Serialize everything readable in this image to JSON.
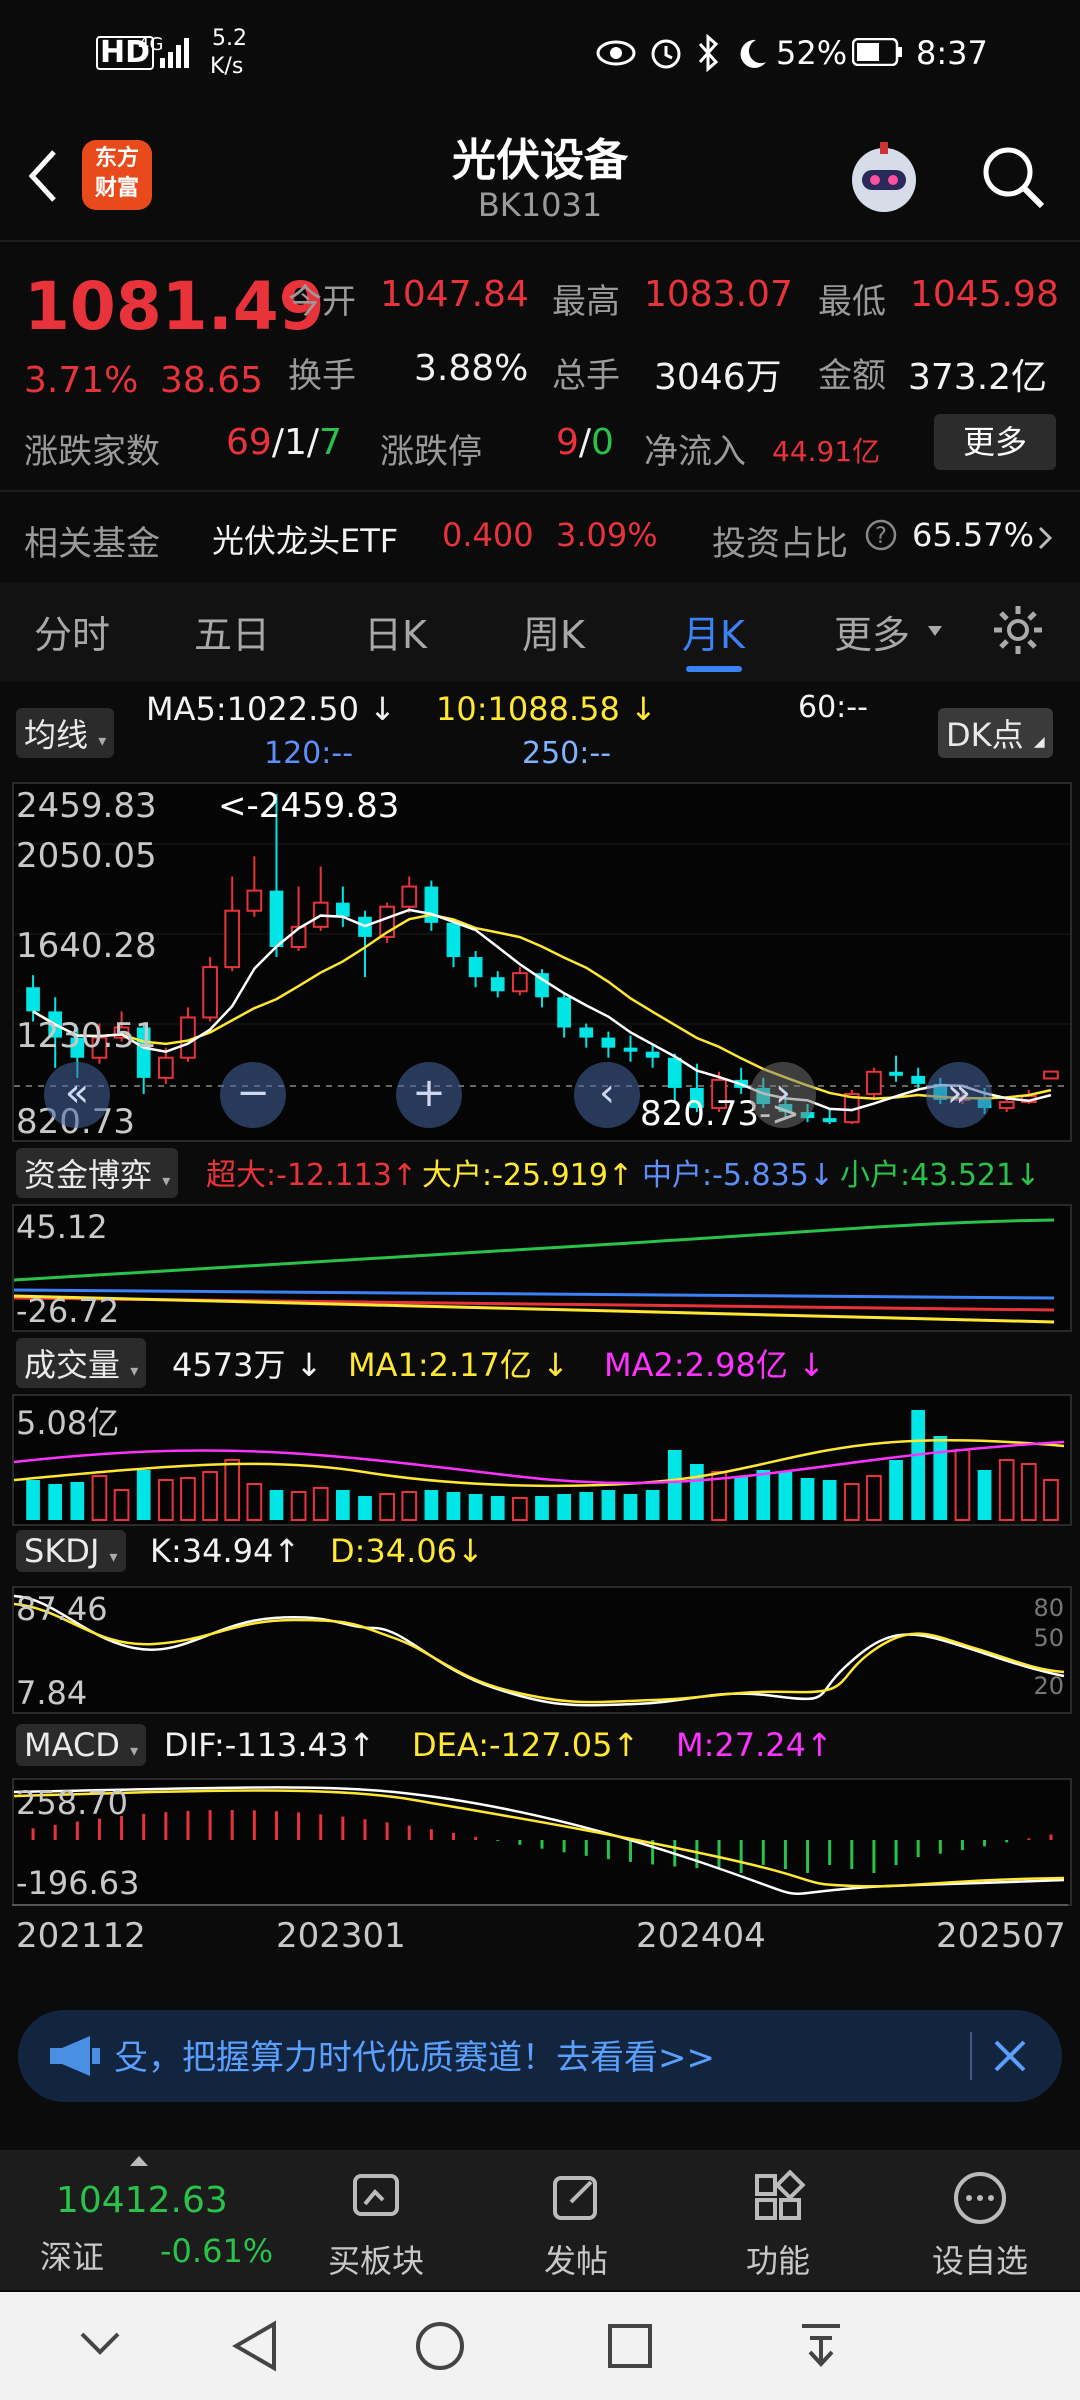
{
  "status": {
    "network": "HD",
    "signal": "4G",
    "speed_value": "5.2",
    "speed_unit": "K/s",
    "battery": "52%",
    "time": "8:37"
  },
  "header": {
    "logo_line1": "东方",
    "logo_line2": "财富",
    "title": "光伏设备",
    "code": "BK1031"
  },
  "quote": {
    "price": "1081.49",
    "pct": "3.71%",
    "chg": "38.65",
    "open_label": "今开",
    "open": "1047.84",
    "high_label": "最高",
    "high": "1083.07",
    "low_label": "最低",
    "low": "1045.98",
    "turnover_label": "换手",
    "turnover": "3.88%",
    "volume_label": "总手",
    "volume": "3046万",
    "amount_label": "金额",
    "amount": "373.2亿",
    "updown_label": "涨跌家数",
    "up": "69",
    "flat": "1",
    "down": "7",
    "limit_label": "涨跌停",
    "limit_up": "9",
    "limit_down": "0",
    "inflow_label": "净流入",
    "inflow": "44.91亿",
    "more": "更多"
  },
  "fund": {
    "label": "相关基金",
    "name": "光伏龙头ETF",
    "price": "0.400",
    "pct": "3.09%",
    "ratio_label": "投资占比",
    "ratio": "65.57%"
  },
  "tabs": [
    "分时",
    "五日",
    "日K",
    "周K",
    "月K",
    "更多"
  ],
  "active_tab": "月K",
  "ma": {
    "chip": "均线",
    "ma5": "MA5:1022.50",
    "ma10": "10:1088.58",
    "ma60": "60:--",
    "ma120": "120:--",
    "ma250": "250:--",
    "dk": "DK点"
  },
  "kline": {
    "top": "2459.83",
    "y2": "2050.05",
    "y3": "1640.28",
    "y4": "1230.51",
    "bottom": "820.73",
    "max_label": "<-2459.83",
    "min_label": "820.73->"
  },
  "fundflow": {
    "chip": "资金博弈",
    "super": "超大:-12.113",
    "big": "大户:-25.919",
    "mid": "中户:-5.835",
    "small": "小户:43.521",
    "top": "45.12",
    "bottom": "-26.72"
  },
  "volume_ind": {
    "chip": "成交量",
    "vol": "4573万",
    "ma1": "MA1:2.17亿",
    "ma2": "MA2:2.98亿",
    "top": "5.08亿"
  },
  "skdj": {
    "chip": "SKDJ",
    "k": "K:34.94",
    "d": "D:34.06",
    "top": "87.46",
    "bottom": "7.84",
    "r80": "80",
    "r50": "50",
    "r20": "20"
  },
  "macd": {
    "chip": "MACD",
    "dif": "DIF:-113.43",
    "dea": "DEA:-127.05",
    "m": "M:27.24",
    "top": "258.70",
    "bottom": "-196.63"
  },
  "dates": [
    "202112",
    "202301",
    "202404",
    "202507"
  ],
  "banner": {
    "text": "殳，把握算力时代优质赛道！去看看>>"
  },
  "bottom": {
    "index_value": "10412.63",
    "index_name": "深证",
    "index_pct": "-0.61%",
    "buy": "买板块",
    "post": "发帖",
    "func": "功能",
    "watch": "设自选"
  },
  "colors": {
    "up": "#e8333a",
    "down": "#00e5e5",
    "ma5": "#ffffff",
    "ma10": "#ffe733",
    "accent": "#3b82f6"
  },
  "chart_data": {
    "type": "candlestick",
    "ylim": [
      820.73,
      2459.83
    ],
    "candles": [
      {
        "o": 1500,
        "c": 1380,
        "h": 1560,
        "l": 1330
      },
      {
        "o": 1380,
        "c": 1250,
        "h": 1450,
        "l": 1100
      },
      {
        "o": 1250,
        "c": 1150,
        "h": 1300,
        "l": 1050
      },
      {
        "o": 1150,
        "c": 1250,
        "h": 1320,
        "l": 1120
      },
      {
        "o": 1250,
        "c": 1300,
        "h": 1380,
        "l": 1230
      },
      {
        "o": 1300,
        "c": 1050,
        "h": 1320,
        "l": 970
      },
      {
        "o": 1050,
        "c": 1150,
        "h": 1200,
        "l": 1020
      },
      {
        "o": 1150,
        "c": 1350,
        "h": 1400,
        "l": 1130
      },
      {
        "o": 1350,
        "c": 1600,
        "h": 1650,
        "l": 1330
      },
      {
        "o": 1600,
        "c": 1880,
        "h": 2050,
        "l": 1580
      },
      {
        "o": 1880,
        "c": 1980,
        "h": 2150,
        "l": 1850
      },
      {
        "o": 1980,
        "c": 1700,
        "h": 2459,
        "l": 1650
      },
      {
        "o": 1700,
        "c": 1800,
        "h": 2000,
        "l": 1680
      },
      {
        "o": 1800,
        "c": 1920,
        "h": 2100,
        "l": 1780
      },
      {
        "o": 1920,
        "c": 1850,
        "h": 2000,
        "l": 1800
      },
      {
        "o": 1850,
        "c": 1750,
        "h": 1880,
        "l": 1550
      },
      {
        "o": 1750,
        "c": 1900,
        "h": 1920,
        "l": 1720
      },
      {
        "o": 1900,
        "c": 2000,
        "h": 2050,
        "l": 1870
      },
      {
        "o": 2000,
        "c": 1820,
        "h": 2030,
        "l": 1780
      },
      {
        "o": 1820,
        "c": 1650,
        "h": 1840,
        "l": 1600
      },
      {
        "o": 1650,
        "c": 1550,
        "h": 1680,
        "l": 1500
      },
      {
        "o": 1550,
        "c": 1480,
        "h": 1580,
        "l": 1450
      },
      {
        "o": 1480,
        "c": 1570,
        "h": 1600,
        "l": 1460
      },
      {
        "o": 1570,
        "c": 1450,
        "h": 1590,
        "l": 1400
      },
      {
        "o": 1450,
        "c": 1300,
        "h": 1470,
        "l": 1250
      },
      {
        "o": 1300,
        "c": 1250,
        "h": 1320,
        "l": 1200
      },
      {
        "o": 1250,
        "c": 1200,
        "h": 1280,
        "l": 1150
      },
      {
        "o": 1200,
        "c": 1180,
        "h": 1260,
        "l": 1130
      },
      {
        "o": 1180,
        "c": 1150,
        "h": 1210,
        "l": 1100
      },
      {
        "o": 1150,
        "c": 1000,
        "h": 1170,
        "l": 930
      },
      {
        "o": 1000,
        "c": 900,
        "h": 1120,
        "l": 880
      },
      {
        "o": 900,
        "c": 1040,
        "h": 1080,
        "l": 880
      },
      {
        "o": 1040,
        "c": 1000,
        "h": 1100,
        "l": 970
      },
      {
        "o": 1000,
        "c": 920,
        "h": 1050,
        "l": 900
      },
      {
        "o": 920,
        "c": 880,
        "h": 980,
        "l": 850
      },
      {
        "o": 880,
        "c": 850,
        "h": 920,
        "l": 830
      },
      {
        "o": 850,
        "c": 830,
        "h": 900,
        "l": 820
      },
      {
        "o": 830,
        "c": 970,
        "h": 990,
        "l": 820
      },
      {
        "o": 970,
        "c": 1080,
        "h": 1100,
        "l": 940
      },
      {
        "o": 1080,
        "c": 1060,
        "h": 1160,
        "l": 1030
      },
      {
        "o": 1060,
        "c": 1020,
        "h": 1100,
        "l": 1000
      },
      {
        "o": 1020,
        "c": 940,
        "h": 1050,
        "l": 920
      },
      {
        "o": 940,
        "c": 950,
        "h": 980,
        "l": 920
      },
      {
        "o": 950,
        "c": 900,
        "h": 1000,
        "l": 870
      },
      {
        "o": 900,
        "c": 930,
        "h": 960,
        "l": 880
      },
      {
        "o": 930,
        "c": 960,
        "h": 990,
        "l": 920
      },
      {
        "o": 1047,
        "c": 1081,
        "h": 1083,
        "l": 1045
      }
    ]
  }
}
